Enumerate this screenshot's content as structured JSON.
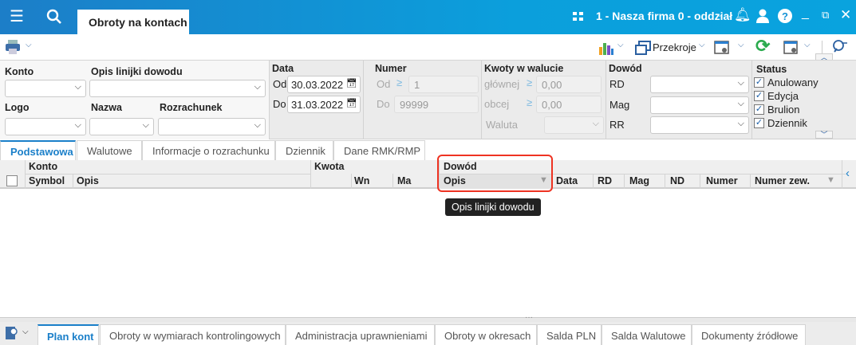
{
  "titlebar": {
    "app_tab": "Obroty na kontach",
    "company": "1 - Nasza firma 0 - oddział"
  },
  "toolbar": {
    "sections_label": "Przekroje"
  },
  "filters": {
    "konto_label": "Konto",
    "opis_label": "Opis linijki dowodu",
    "logo_label": "Logo",
    "nazwa_label": "Nazwa",
    "rozrachunek_label": "Rozrachunek",
    "data": {
      "label": "Data",
      "od_label": "Od",
      "od_value": "30.03.2022",
      "do_label": "Do",
      "do_value": "31.03.2022"
    },
    "numer": {
      "label": "Numer",
      "od_label": "Od",
      "od_value": "1",
      "do_label": "Do",
      "do_value": "99999"
    },
    "kwoty": {
      "label": "Kwoty w walucie",
      "glownej_label": "głównej",
      "glownej_value": "0,00",
      "obcej_label": "obcej",
      "obcej_value": "0,00",
      "waluta_label": "Waluta"
    },
    "dowod": {
      "label": "Dowód",
      "rd_label": "RD",
      "mag_label": "Mag",
      "rr_label": "RR"
    },
    "status": {
      "label": "Status",
      "items": [
        {
          "label": "Anulowany",
          "checked": true
        },
        {
          "label": "Edycja",
          "checked": true
        },
        {
          "label": "Brulion",
          "checked": true
        },
        {
          "label": "Dziennik",
          "checked": true
        }
      ]
    }
  },
  "tabs": [
    "Podstawowa",
    "Walutowe",
    "Informacje o rozrachunku",
    "Dziennik",
    "Dane RMK/RMP"
  ],
  "grid": {
    "konto": "Konto",
    "symbol": "Symbol",
    "opis": "Opis",
    "kwota": "Kwota",
    "wn": "Wn",
    "ma": "Ma",
    "dowod": "Dowód",
    "dowod_opis": "Opis",
    "data": "Data",
    "rd": "RD",
    "mag": "Mag",
    "nd": "ND",
    "numer": "Numer",
    "numer_zew": "Numer zew."
  },
  "tooltip": "Opis linijki dowodu",
  "bottom_tabs": [
    "Plan kont",
    "Obroty w wymiarach kontrolingowych",
    "Administracja uprawnieniami",
    "Obroty w okresach",
    "Salda PLN",
    "Salda Walutowe",
    "Dokumenty źródłowe"
  ],
  "colors": {
    "accent": "#1a7fc9",
    "highlight": "#e33322"
  }
}
